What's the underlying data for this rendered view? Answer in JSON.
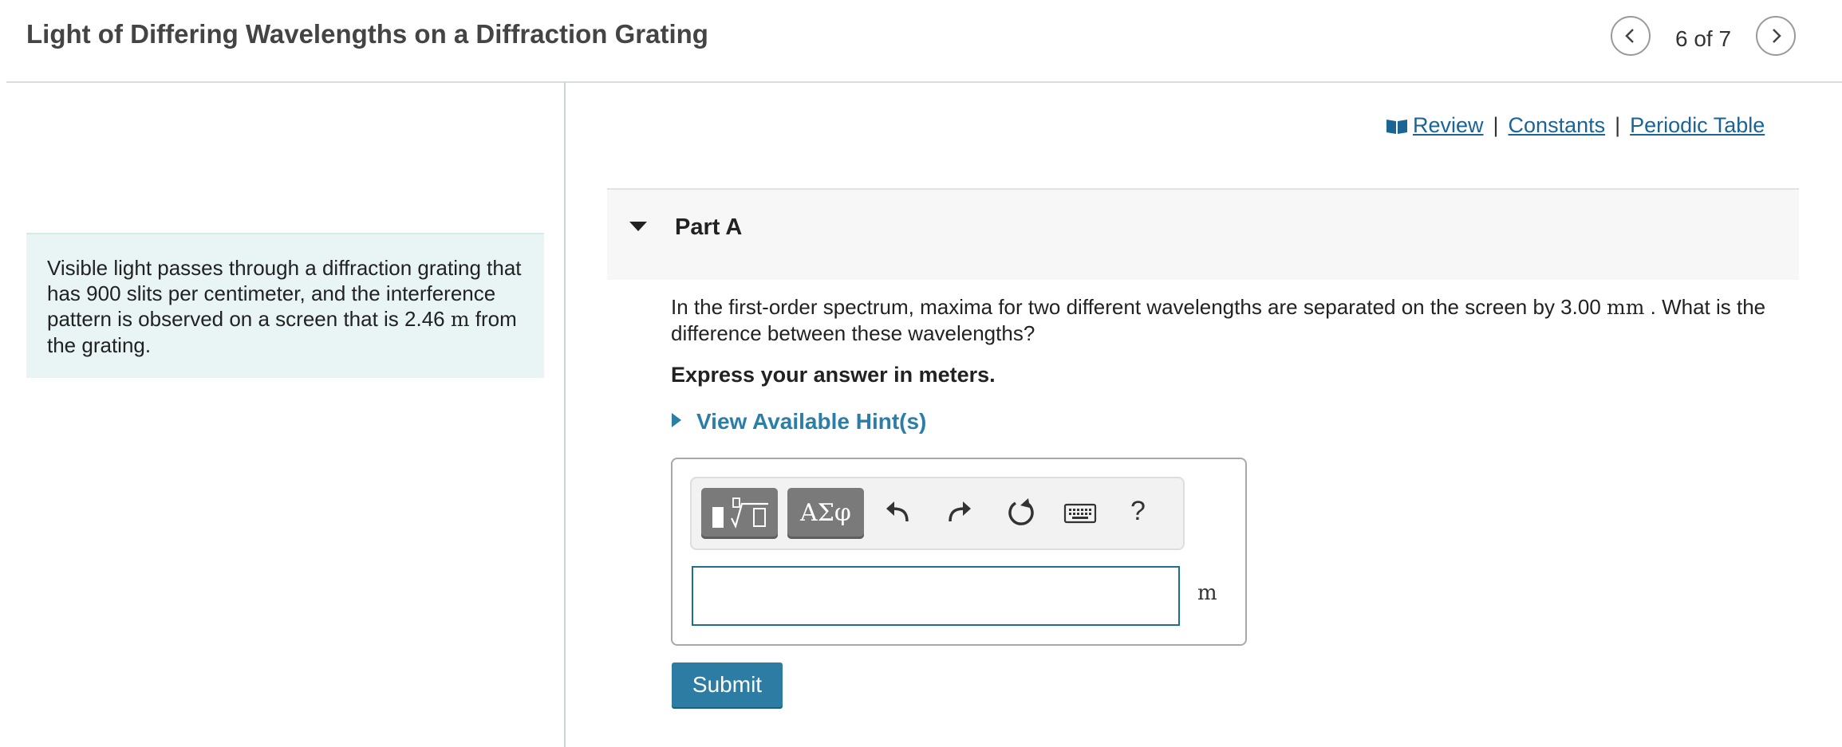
{
  "header": {
    "title": "Light of Differing Wavelengths on a Diffraction Grating",
    "counter": "6 of 7",
    "prev_icon": "chevron-left-icon",
    "next_icon": "chevron-right-icon"
  },
  "intro": {
    "text_before": "Visible light passes through a diffraction grating that has 900 slits per centimeter, and the interference pattern is observed on a screen that is 2.46 ",
    "unit": "m",
    "text_after": " from the grating."
  },
  "links": {
    "review": "Review",
    "constants": "Constants",
    "periodic_table": "Periodic Table",
    "separator": "|"
  },
  "part": {
    "label": "Part A",
    "question_before": "In the first-order spectrum, maxima for two different wavelengths are separated on the screen by 3.00 ",
    "question_unit": "mm",
    "question_after": " . What is the difference between these wavelengths?",
    "instruction": "Express your answer in meters.",
    "hints_label": "View Available Hint(s)"
  },
  "answer": {
    "greek_label": "ΑΣφ",
    "help_label": "?",
    "value": "",
    "unit": "m",
    "submit_label": "Submit"
  },
  "colors": {
    "link": "#1a6496",
    "hint": "#2a7ea8",
    "submit": "#2d7ca3",
    "intro_bg": "#e8f5f4"
  }
}
